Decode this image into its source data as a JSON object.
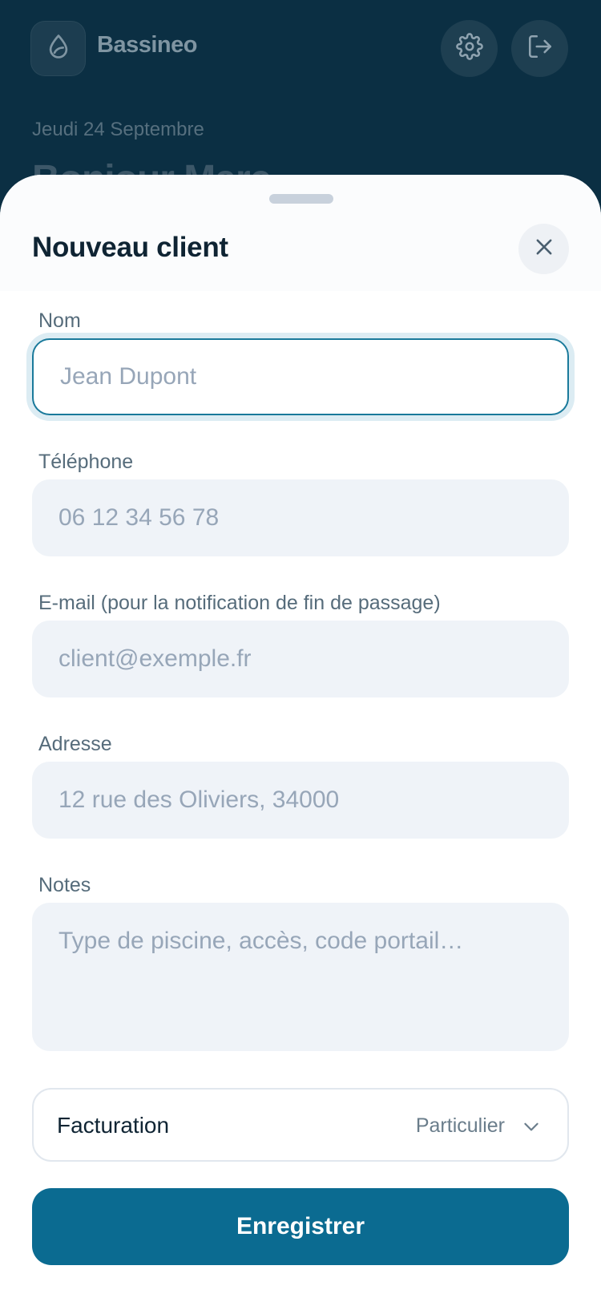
{
  "app": {
    "name": "Bassineo"
  },
  "header": {
    "date": "Jeudi 24 Septembre",
    "greeting": "Bonjour Marc",
    "settings_icon": "gear-icon",
    "logout_icon": "logout-icon",
    "logo_icon": "water-drop-icon"
  },
  "sheet": {
    "title": "Nouveau client",
    "close_icon": "close-icon"
  },
  "form": {
    "name": {
      "label": "Nom",
      "placeholder": "Jean Dupont",
      "value": ""
    },
    "phone": {
      "label": "Téléphone",
      "placeholder": "06 12 34 56 78",
      "value": ""
    },
    "email": {
      "label": "E-mail (pour la notification de fin de passage)",
      "placeholder": "client@exemple.fr",
      "value": ""
    },
    "address": {
      "label": "Adresse",
      "placeholder": "12 rue des Oliviers, 34000",
      "value": ""
    },
    "notes": {
      "label": "Notes",
      "placeholder": "Type de piscine, accès, code portail…",
      "value": ""
    },
    "billing": {
      "label": "Facturation",
      "value": "Particulier",
      "icon": "chevron-down-icon"
    }
  },
  "actions": {
    "save_label": "Enregistrer"
  },
  "colors": {
    "header_bg": "#0b2f43",
    "accent": "#0b6b91",
    "focus_border": "#1a7a9b"
  }
}
